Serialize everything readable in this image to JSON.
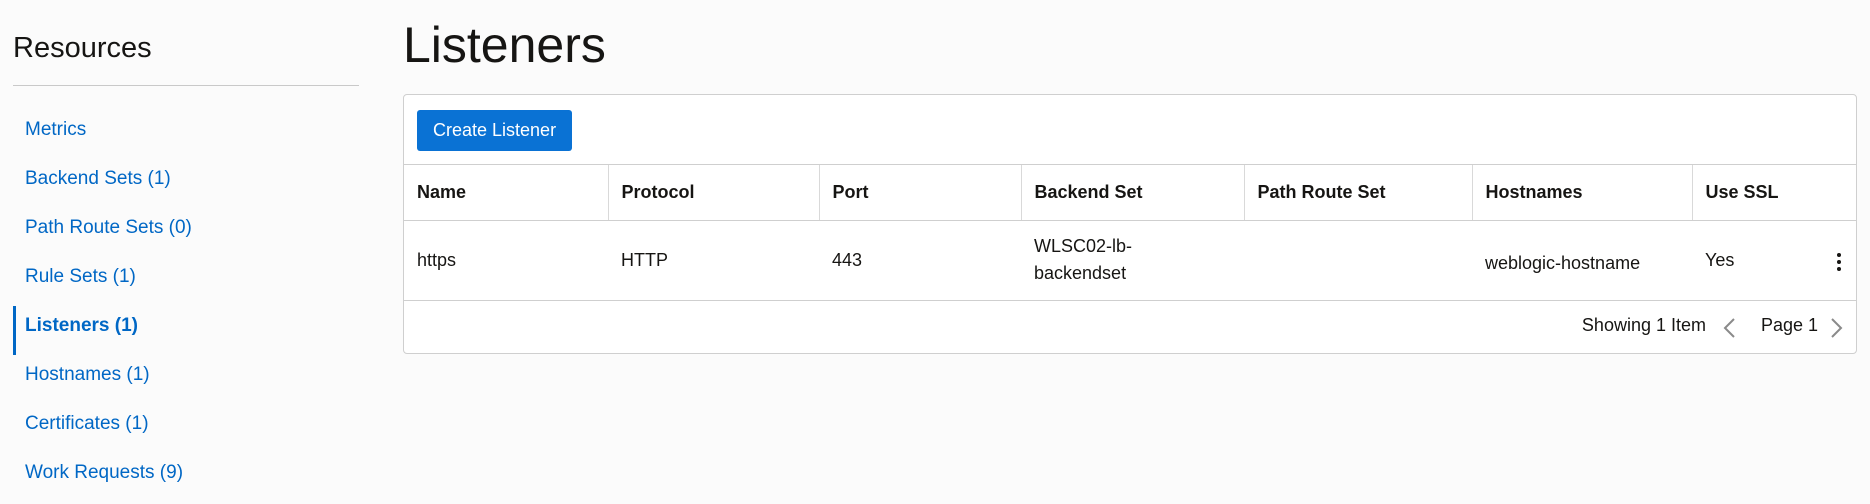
{
  "sidebar": {
    "title": "Resources",
    "items": [
      {
        "label": "Metrics"
      },
      {
        "label": "Backend Sets (1)"
      },
      {
        "label": "Path Route Sets (0)"
      },
      {
        "label": "Rule Sets (1)"
      },
      {
        "label": "Listeners (1)"
      },
      {
        "label": "Hostnames (1)"
      },
      {
        "label": "Certificates (1)"
      },
      {
        "label": "Work Requests (9)"
      }
    ],
    "active_index": 4
  },
  "main": {
    "title": "Listeners",
    "create_button": "Create Listener",
    "table": {
      "columns": [
        "Name",
        "Protocol",
        "Port",
        "Backend Set",
        "Path Route Set",
        "Hostnames",
        "Use SSL"
      ],
      "rows": [
        {
          "name": "https",
          "protocol": "HTTP",
          "port": "443",
          "backend_set": "WLSC02-lb-backendset",
          "path_route_set": "",
          "hostnames": "weblogic-hostname",
          "use_ssl": "Yes"
        }
      ]
    },
    "footer": {
      "showing": "Showing 1 Item",
      "page": "Page 1"
    }
  },
  "colors": {
    "accent": "#0067c5",
    "button": "#0a72d4",
    "text": "#161513",
    "border": "#cfcfcf"
  },
  "icons": {
    "kebab": "more-options-icon",
    "prev": "chevron-left-icon",
    "next": "chevron-right-icon"
  }
}
